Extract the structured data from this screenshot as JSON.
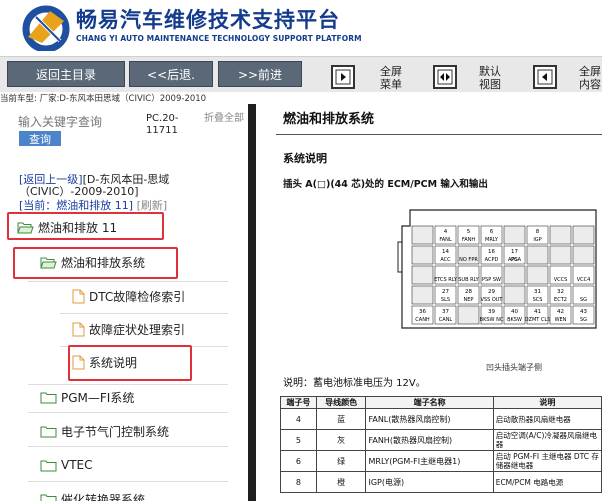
{
  "brand": {
    "title": "畅易汽车维修技术支持平台",
    "subtitle": "CHANG YI AUTO MAINTENANCE TECHNOLOGY SUPPORT PLATFORM"
  },
  "toolbar": {
    "home_label": "返回主目录",
    "back_label": "<<后退.",
    "forward_label": ">>前进",
    "fullscreen_menu_label": "全屏\n菜单",
    "default_view_label": "默认\n视图",
    "fullscreen_content_label": "全屏\n内容"
  },
  "car_path": "当前车型:  厂家:D-东风本田思域（CIVIC）2009-2010",
  "search": {
    "placeholder": "输入关键字查询",
    "button_label": "查询",
    "pc_code": "PC.20-11711",
    "collapse_all_label": "折叠全部"
  },
  "breadcrumb": {
    "back_label": "[返回上一级]",
    "model": "[D-东风本田-思域（CIVIC）-2009-2010]",
    "current_label": "[当前：燃油和排放 11]",
    "refresh_label": "[刷新]"
  },
  "tree": {
    "root": "燃油和排放 11",
    "section": "燃油和排放系统",
    "doc_dtc": "DTC故障检修索引",
    "doc_symptom": "故障症状处理索引",
    "doc_system": "系统说明",
    "folder_pgm": "PGM—FI系统",
    "folder_throttle": "电子节气门控制系统",
    "folder_vtec": "VTEC",
    "folder_catalyst": "催化转换器系统"
  },
  "document": {
    "title": "燃油和排放系统",
    "section_title": "系统说明",
    "connector_title": "插头 A(□)(44 芯)处的 ECM/PCM 输入和输出",
    "pin_caption": "凹头插头端子侧",
    "voltage_note": "说明：蓄电池标准电压为 12V。",
    "connector_pins": {
      "row1": [
        "",
        "4",
        "5",
        "6",
        "",
        "8",
        "",
        ""
      ],
      "row1_names": [
        "",
        "FANL",
        "FANH",
        "MRLY",
        "",
        "IGP",
        "",
        ""
      ],
      "row2": [
        "",
        "14",
        "",
        "16",
        "17",
        "",
        "",
        ""
      ],
      "row2_names": [
        "",
        "ACC",
        "",
        "ACPD",
        "APSA",
        "",
        "",
        ""
      ],
      "row3": [
        "",
        "ETCS RLY",
        "SUB RLY",
        "PSP SW",
        "",
        "",
        "VCCS",
        "VCC4"
      ],
      "row4": [
        "",
        "27",
        "28",
        "29",
        "",
        "31",
        "32",
        ""
      ],
      "row4_names": [
        "",
        "SLS",
        "NEP",
        "VSS OUT",
        "",
        "SCS",
        "ECT2",
        "SG"
      ],
      "row5": [
        "36",
        "37",
        "",
        "39",
        "40",
        "41",
        "42",
        "43"
      ],
      "row5_names": [
        "CANH",
        "CANL",
        "",
        "BKSW NC",
        "BKSW",
        "OZMT CLS",
        "WEN",
        "SG"
      ],
      "row2_extra": [
        "NO FPR",
        "PG"
      ]
    },
    "table_headers": [
      "端子号",
      "导线颜色",
      "端子名称",
      "说明"
    ],
    "table_rows": [
      {
        "pin": "4",
        "color": "蓝",
        "name": "FANL(散热器风扇控制)",
        "desc": "启动散热器风扇继电器"
      },
      {
        "pin": "5",
        "color": "灰",
        "name": "FANH(散热器风扇控制)",
        "desc": "启动空调(A/C)冷凝器风扇继电器"
      },
      {
        "pin": "6",
        "color": "绿",
        "name": "MRLY(PGM-FI主继电器1)",
        "desc": "启动 PGM-FI 主继电器 DTC 存储器继电器"
      },
      {
        "pin": "8",
        "color": "橙",
        "name": "IGP(电源)",
        "desc": "ECM/PCM 电路电源"
      }
    ]
  }
}
